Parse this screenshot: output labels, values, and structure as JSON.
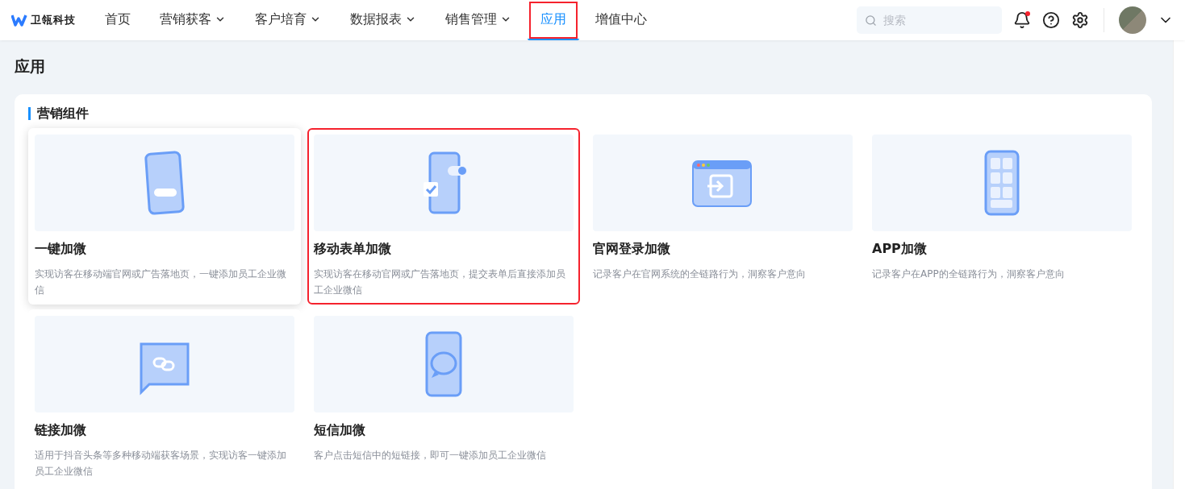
{
  "brand": {
    "name": "卫瓴科技"
  },
  "nav": [
    {
      "label": "首页",
      "dropdown": false,
      "selected": false,
      "highlighted": false
    },
    {
      "label": "营销获客",
      "dropdown": true,
      "selected": false,
      "highlighted": false
    },
    {
      "label": "客户培育",
      "dropdown": true,
      "selected": false,
      "highlighted": false
    },
    {
      "label": "数据报表",
      "dropdown": true,
      "selected": false,
      "highlighted": false
    },
    {
      "label": "销售管理",
      "dropdown": true,
      "selected": false,
      "highlighted": false
    },
    {
      "label": "应用",
      "dropdown": false,
      "selected": true,
      "highlighted": true
    },
    {
      "label": "增值中心",
      "dropdown": false,
      "selected": false,
      "highlighted": false
    }
  ],
  "search": {
    "placeholder": "搜索"
  },
  "notifications": {
    "unread": true
  },
  "page_title": "应用",
  "section": {
    "title": "营销组件",
    "cards": [
      {
        "kind": "phone-button",
        "title": "一键加微",
        "description": "实现访客在移动端官网或广告落地页，一键添加员工企业微信",
        "hovered": true,
        "highlighted": false
      },
      {
        "kind": "phone-form",
        "title": "移动表单加微",
        "description": "实现访客在移动官网或广告落地页，提交表单后直接添加员工企业微信",
        "hovered": false,
        "highlighted": true
      },
      {
        "kind": "browser-login",
        "title": "官网登录加微",
        "description": "记录客户在官网系统的全链路行为，洞察客户意向",
        "hovered": false,
        "highlighted": false
      },
      {
        "kind": "app-grid",
        "title": "APP加微",
        "description": "记录客户在APP的全链路行为，洞察客户意向",
        "hovered": false,
        "highlighted": false
      },
      {
        "kind": "link-chat",
        "title": "链接加微",
        "description": "适用于抖音头条等多种移动端获客场景，实现访客一键添加员工企业微信",
        "hovered": false,
        "highlighted": false
      },
      {
        "kind": "sms-chat",
        "title": "短信加微",
        "description": "客户点击短信中的短链接，即可一键添加员工企业微信",
        "hovered": false,
        "highlighted": false
      }
    ]
  }
}
